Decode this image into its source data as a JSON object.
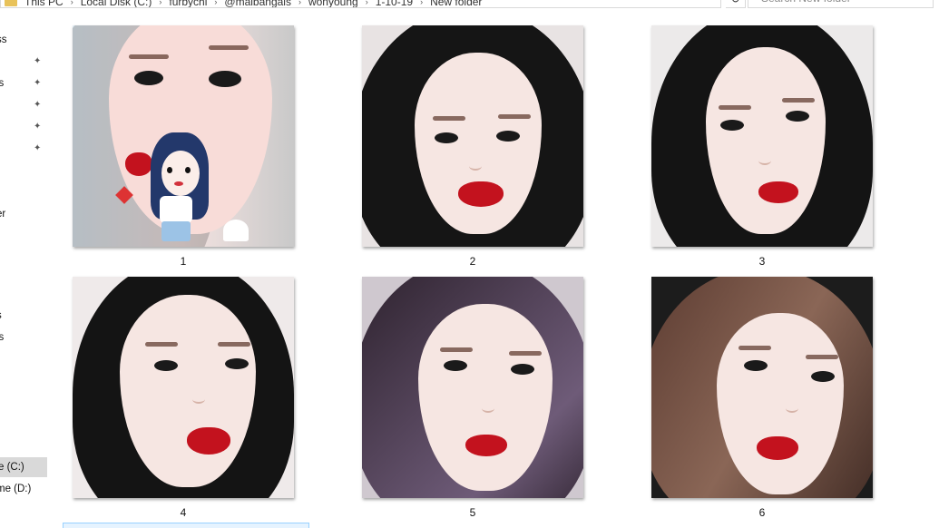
{
  "address_bar": {
    "crumbs": [
      "This PC",
      "Local Disk (C:)",
      "furbychi",
      "@maibangais",
      "wonyoung",
      "1-10-19",
      "New folder"
    ],
    "refresh_glyph": "↻",
    "dropdown_glyph": "⌄"
  },
  "search": {
    "placeholder": "Search New folder"
  },
  "nav": {
    "items": [
      {
        "label": "ss",
        "pinned": false
      },
      {
        "label": "",
        "pinned": true
      },
      {
        "label": "ls",
        "pinned": true
      },
      {
        "label": "",
        "pinned": true
      },
      {
        "label": "",
        "pinned": true
      },
      {
        "label": "",
        "pinned": true
      },
      {
        "label": "er",
        "pinned": false
      },
      {
        "label": "s",
        "pinned": false
      },
      {
        "label": "ls",
        "pinned": false
      },
      {
        "label": "e (C:)",
        "pinned": false,
        "selected": true
      },
      {
        "label": "me (D:)",
        "pinned": false
      }
    ],
    "pin_glyph": "📌"
  },
  "files": [
    {
      "name": "1"
    },
    {
      "name": "2"
    },
    {
      "name": "3"
    },
    {
      "name": "4"
    },
    {
      "name": "5"
    },
    {
      "name": "6"
    }
  ],
  "colors": {
    "selection": "#e5f3ff",
    "selection_border": "#99d1ff",
    "nav_selected": "#d9d9d9"
  }
}
